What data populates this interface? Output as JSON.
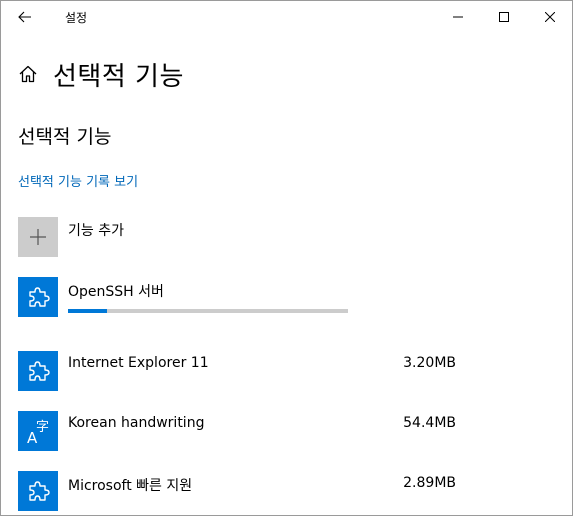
{
  "window": {
    "title": "설정"
  },
  "header": {
    "title": "선택적 기능"
  },
  "section": {
    "title": "선택적 기능",
    "history_link": "선택적 기능 기록 보기"
  },
  "add_feature": {
    "label": "기능 추가"
  },
  "installing": {
    "name": "OpenSSH 서버",
    "progress": 0.14
  },
  "features": [
    {
      "name": "Internet Explorer 11",
      "size": "3.20MB",
      "icon": "puzzle-icon"
    },
    {
      "name": "Korean handwriting",
      "size": "54.4MB",
      "icon": "language-icon",
      "icon_text_a": "A",
      "icon_text_b": "字"
    },
    {
      "name": "Microsoft 빠른 지원",
      "size": "2.89MB",
      "icon": "puzzle-icon"
    }
  ],
  "colors": {
    "accent": "#0078d7",
    "link": "#0067b8",
    "tile_gray": "#cccccc"
  }
}
